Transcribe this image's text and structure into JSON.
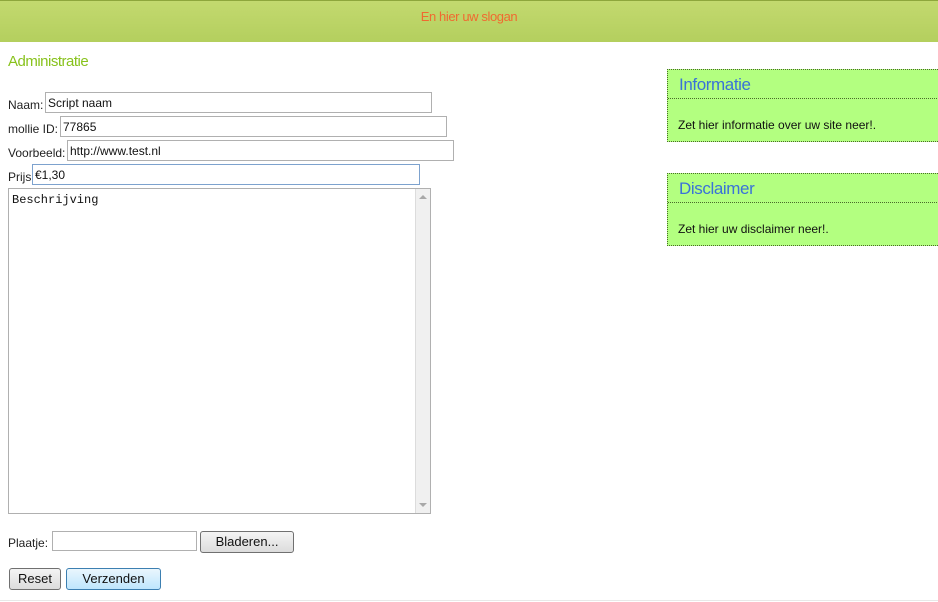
{
  "header": {
    "slogan": "En hier uw slogan"
  },
  "page": {
    "title": "Administratie"
  },
  "form": {
    "naam": {
      "label": "Naam:",
      "value": "Script naam"
    },
    "mollie": {
      "label": "mollie ID:",
      "value": "77865"
    },
    "voorbeeld": {
      "label": "Voorbeeld:",
      "value": "http://www.test.nl"
    },
    "prijs": {
      "label": "Prijs",
      "value": "€1,30"
    },
    "beschrijving": {
      "value": "Beschrijving"
    },
    "plaatje": {
      "label": "Plaatje:",
      "browse_label": "Bladeren..."
    },
    "reset_label": "Reset",
    "submit_label": "Verzenden"
  },
  "sidebar": {
    "informatie": {
      "title": "Informatie",
      "text": "Zet hier informatie over uw site neer!."
    },
    "disclaimer": {
      "title": "Disclaimer",
      "text": "Zet hier uw disclaimer neer!."
    }
  },
  "colors": {
    "header": "#b9d364",
    "slogan": "#f06a30",
    "title": "#88c21c",
    "sidebox_bg": "#b3ff80",
    "sidebox_title": "#3a72d8"
  }
}
